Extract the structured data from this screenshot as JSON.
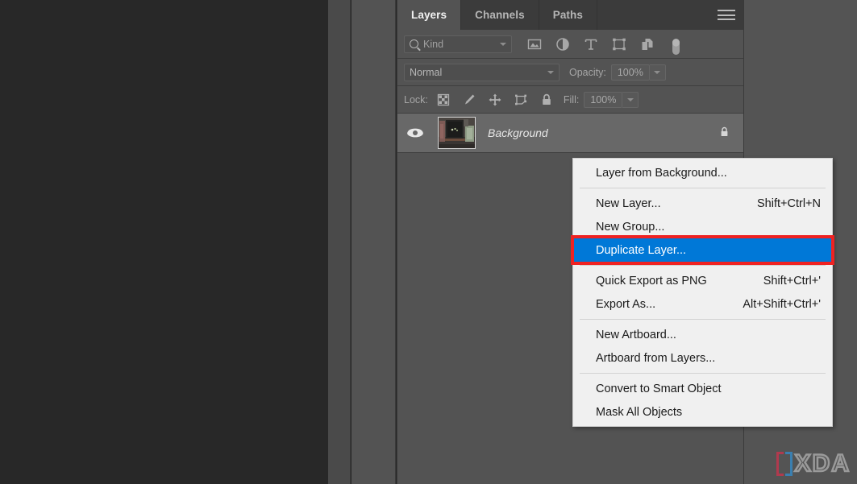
{
  "panel": {
    "tabs": [
      {
        "label": "Layers",
        "active": true
      },
      {
        "label": "Channels",
        "active": false
      },
      {
        "label": "Paths",
        "active": false
      }
    ],
    "menu_icon": "hamburger-menu-icon",
    "filter": {
      "kind_label": "Kind",
      "search_icon": "search-icon",
      "dropdown_icon": "chevron-down-icon",
      "icons": [
        "pixel-layer-filter-icon",
        "adjustment-layer-filter-icon",
        "type-layer-filter-icon",
        "shape-layer-filter-icon",
        "smart-object-filter-icon",
        "filter-toggle-switch-icon"
      ]
    },
    "blend": {
      "mode": "Normal",
      "opacity_label": "Opacity:",
      "opacity_value": "100%"
    },
    "lock": {
      "label": "Lock:",
      "fill_label": "Fill:",
      "fill_value": "100%",
      "icons": [
        "lock-transparent-pixels-icon",
        "lock-image-pixels-icon",
        "lock-position-icon",
        "lock-artboard-nesting-icon",
        "lock-all-icon"
      ]
    },
    "layers": [
      {
        "name": "Background",
        "visibility_icon": "eye-icon",
        "thumbnail": "layer-thumbnail",
        "lock_icon": "lock-icon",
        "selected": true
      }
    ]
  },
  "context_menu": {
    "groups": [
      {
        "items": [
          {
            "label": "Layer from Background...",
            "shortcut": "",
            "selected": false
          }
        ]
      },
      {
        "items": [
          {
            "label": "New Layer...",
            "shortcut": "Shift+Ctrl+N",
            "selected": false
          },
          {
            "label": "New Group...",
            "shortcut": "",
            "selected": false
          },
          {
            "label": "Duplicate Layer...",
            "shortcut": "",
            "selected": true
          }
        ]
      },
      {
        "items": [
          {
            "label": "Quick Export as PNG",
            "shortcut": "Shift+Ctrl+'",
            "selected": false
          },
          {
            "label": "Export As...",
            "shortcut": "Alt+Shift+Ctrl+'",
            "selected": false
          }
        ]
      },
      {
        "items": [
          {
            "label": "New Artboard...",
            "shortcut": "",
            "selected": false
          },
          {
            "label": "Artboard from Layers...",
            "shortcut": "",
            "selected": false
          }
        ]
      },
      {
        "items": [
          {
            "label": "Convert to Smart Object",
            "shortcut": "",
            "selected": false
          },
          {
            "label": "Mask All Objects",
            "shortcut": "",
            "selected": false
          }
        ]
      }
    ],
    "highlight_color": "#0078d7",
    "annotation_box_color": "#ef2222"
  },
  "watermark": {
    "text": "XDA",
    "left_bracket_color": "#b03a4e",
    "right_bracket_color": "#3a7fb0",
    "text_color": "#9a9a9a"
  },
  "colors": {
    "canvas_background": "#282828",
    "panel_background": "#535353",
    "tabbar_background": "#3b3b3b",
    "layer_row_selected": "#686868",
    "menu_background": "#f0f0f0"
  }
}
